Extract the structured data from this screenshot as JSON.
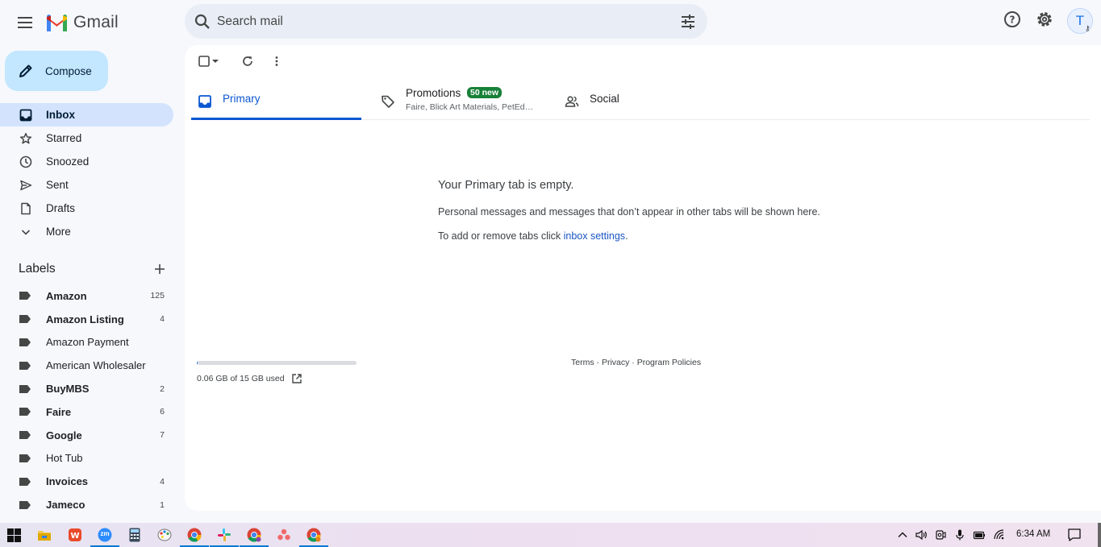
{
  "header": {
    "app_name": "Gmail",
    "search_placeholder": "Search mail",
    "avatar_letter": "T"
  },
  "compose_label": "Compose",
  "nav": [
    {
      "label": "Inbox",
      "icon": "inbox-icon",
      "active": true
    },
    {
      "label": "Starred",
      "icon": "star-icon"
    },
    {
      "label": "Snoozed",
      "icon": "clock-icon"
    },
    {
      "label": "Sent",
      "icon": "send-icon"
    },
    {
      "label": "Drafts",
      "icon": "draft-icon"
    },
    {
      "label": "More",
      "icon": "chevron-down-icon"
    }
  ],
  "labels_title": "Labels",
  "labels": [
    {
      "name": "Amazon",
      "count": "125",
      "bold": true
    },
    {
      "name": "Amazon Listing",
      "count": "4",
      "bold": true
    },
    {
      "name": "Amazon Payment",
      "count": "",
      "bold": false
    },
    {
      "name": "American Wholesaler",
      "count": "",
      "bold": false
    },
    {
      "name": "BuyMBS",
      "count": "2",
      "bold": true
    },
    {
      "name": "Faire",
      "count": "6",
      "bold": true
    },
    {
      "name": "Google",
      "count": "7",
      "bold": true
    },
    {
      "name": "Hot Tub",
      "count": "",
      "bold": false
    },
    {
      "name": "Invoices",
      "count": "4",
      "bold": true
    },
    {
      "name": "Jameco",
      "count": "1",
      "bold": true
    }
  ],
  "tabs": {
    "primary": "Primary",
    "promotions": "Promotions",
    "promotions_badge": "50 new",
    "promotions_sub": "Faire, Blick Art Materials, PetEd…",
    "social": "Social"
  },
  "empty": {
    "heading": "Your Primary tab is empty.",
    "line1": "Personal messages and messages that don’t appear in other tabs will be shown here.",
    "line2_prefix": "To add or remove tabs click ",
    "line2_link": "inbox settings",
    "line2_suffix": "."
  },
  "storage": {
    "text": "0.06 GB of 15 GB used",
    "used_fraction": 0.004
  },
  "footer": {
    "terms": "Terms",
    "sep1": " · ",
    "privacy": "Privacy",
    "sep2": " · ",
    "policies": "Program Policies"
  },
  "taskbar": {
    "time": "6:34 AM",
    "zoom_label": "zm"
  },
  "colors": {
    "accent": "#0b57d0",
    "compose_bg": "#c2e7ff",
    "active_nav_bg": "#d3e3fd",
    "badge_green": "#188038"
  }
}
